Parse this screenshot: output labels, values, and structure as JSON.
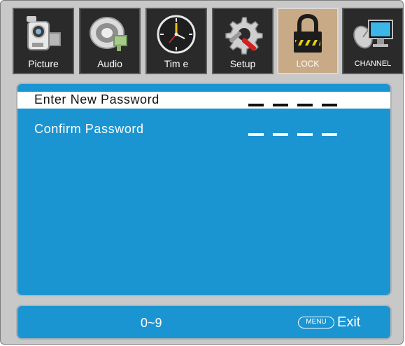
{
  "tabs": [
    {
      "label": "Picture",
      "icon": "camera-icon"
    },
    {
      "label": "Audio",
      "icon": "speaker-icon"
    },
    {
      "label": "Tim e",
      "icon": "clock-icon"
    },
    {
      "label": "Setup",
      "icon": "gear-tools-icon"
    },
    {
      "label": "LOCK",
      "icon": "padlock-icon",
      "active": true
    },
    {
      "label": "CHANNEL",
      "icon": "satellite-monitor-icon"
    }
  ],
  "password": {
    "new_label": "Enter New Password",
    "confirm_label": "Confirm Password",
    "entered_digits": 0,
    "length": 4
  },
  "footer": {
    "digits_hint": "0~9",
    "menu_key": "MENU",
    "exit_label": "Exit"
  },
  "colors": {
    "panel_blue": "#1b95d2",
    "active_tab": "#c9aa86",
    "tab_bg": "#2a2a2a",
    "frame": "#c8c8c8"
  }
}
